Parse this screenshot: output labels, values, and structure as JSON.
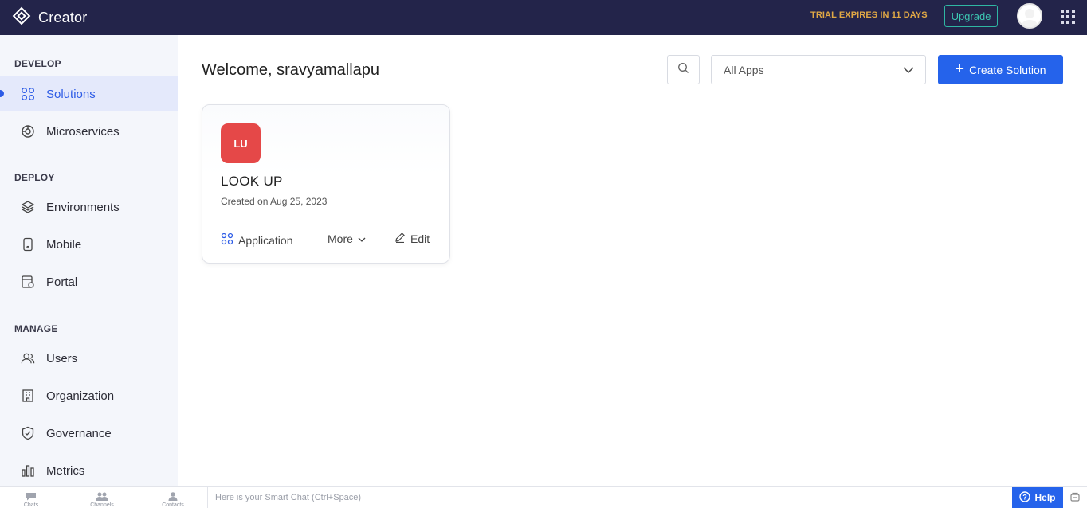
{
  "header": {
    "brand": "Creator",
    "trial_text": "TRIAL EXPIRES IN 11 DAYS",
    "upgrade_label": "Upgrade",
    "icons": [
      "creator-logo-icon",
      "avatar",
      "apps-grid-icon"
    ]
  },
  "sidebar": {
    "sections": [
      {
        "title": "DEVELOP",
        "items": [
          {
            "label": "Solutions",
            "icon": "solutions-icon",
            "active": true
          },
          {
            "label": "Microservices",
            "icon": "microservices-icon"
          }
        ]
      },
      {
        "title": "DEPLOY",
        "items": [
          {
            "label": "Environments",
            "icon": "layers-icon"
          },
          {
            "label": "Mobile",
            "icon": "mobile-icon"
          },
          {
            "label": "Portal",
            "icon": "portal-icon"
          }
        ]
      },
      {
        "title": "MANAGE",
        "items": [
          {
            "label": "Users",
            "icon": "users-icon"
          },
          {
            "label": "Organization",
            "icon": "building-icon"
          },
          {
            "label": "Governance",
            "icon": "shield-icon"
          },
          {
            "label": "Metrics",
            "icon": "bar-chart-icon"
          }
        ]
      }
    ]
  },
  "main": {
    "welcome": "Welcome, sravyamallapu",
    "filter_value": "All Apps",
    "create_label": "Create Solution",
    "card": {
      "badge": "LU",
      "badge_color": "#e54848",
      "title": "LOOK UP",
      "created": "Created on Aug 25, 2023",
      "application_label": "Application",
      "more_label": "More",
      "edit_label": "Edit"
    }
  },
  "bottom": {
    "tabs": [
      "Chats",
      "Channels",
      "Contacts"
    ],
    "smart_chat_placeholder": "Here is your Smart Chat (Ctrl+Space)",
    "help_label": "Help"
  },
  "colors": {
    "topbar": "#23244a",
    "accent": "#2563eb",
    "trial": "#e0a845",
    "upgrade": "#3cc7b2",
    "sidebar_bg": "#f4f6fb"
  }
}
